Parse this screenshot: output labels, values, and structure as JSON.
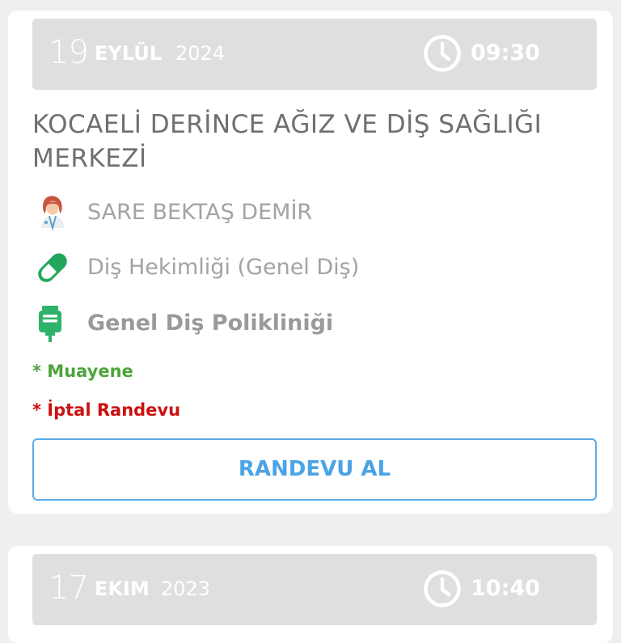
{
  "appointments": [
    {
      "day": "19",
      "month": "EYLÜL",
      "year": "2024",
      "time": "09:30",
      "clinic": "KOCAELİ DERİNCE AĞIZ VE DİŞ SAĞLIĞI MERKEZİ",
      "doctor": "SARE BEKTAŞ DEMİR",
      "branch": "Diş Hekimliği (Genel Diş)",
      "polyclinic": "Genel Diş Polikliniği",
      "type_tag": "* Muayene",
      "status_tag": "* İptal Randevu",
      "button_label": "RANDEVU AL"
    },
    {
      "day": "17",
      "month": "EKIM",
      "year": "2023",
      "time": "10:40"
    }
  ],
  "icons": {
    "clock": "clock-icon",
    "doctor": "female-doctor-icon",
    "branch": "pill-capsule-icon",
    "polyclinic": "iv-bag-icon"
  },
  "colors": {
    "date_bar": "#dfdfdf",
    "type_tag": "#4da43b",
    "status_tag": "#cc1010",
    "button": "#4aa3e6",
    "pill": "#22a65a",
    "iv_bag": "#2fb36b"
  }
}
